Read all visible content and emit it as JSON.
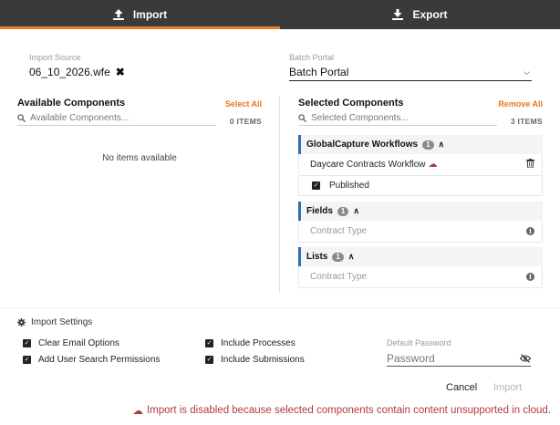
{
  "tabs": [
    {
      "label": "Import",
      "icon": "upload-icon",
      "active": true
    },
    {
      "label": "Export",
      "icon": "download-icon",
      "active": false
    }
  ],
  "import_source": {
    "label": "Import Source",
    "value": "06_10_2026.wfe"
  },
  "batch_portal": {
    "label": "Batch Portal",
    "selected": "Batch Portal"
  },
  "available": {
    "title": "Available Components",
    "action": "Select All",
    "search_placeholder": "Available Components...",
    "count": "0 ITEMS",
    "empty_text": "No items available"
  },
  "selected": {
    "title": "Selected Components",
    "action": "Remove All",
    "search_placeholder": "Selected Components...",
    "count": "3 ITEMS",
    "groups": [
      {
        "name": "GlobalCapture Workflows",
        "badge": "1",
        "items": [
          {
            "label": "Daycare Contracts Workflow",
            "icon": "cloud-icon",
            "action_icon": "trash-icon"
          }
        ],
        "checkbox": {
          "label": "Published",
          "checked": true
        }
      },
      {
        "name": "Fields",
        "badge": "1",
        "items": [
          {
            "label": "Contract Type",
            "action_icon": "info-icon"
          }
        ]
      },
      {
        "name": "Lists",
        "badge": "1",
        "items": [
          {
            "label": "Contract Type",
            "action_icon": "info-icon"
          }
        ]
      }
    ]
  },
  "settings": {
    "title": "Import Settings",
    "options": [
      {
        "label": "Clear Email Options",
        "checked": true
      },
      {
        "label": "Include Processes",
        "checked": true
      },
      {
        "label": "Add User Search Permissions",
        "checked": true
      },
      {
        "label": "Include Submissions",
        "checked": true
      }
    ],
    "password_label": "Default Password",
    "password_placeholder": "Password"
  },
  "buttons": {
    "cancel": "Cancel",
    "import": "Import"
  },
  "error": "Import is disabled because selected components contain content unsupported in cloud.",
  "colors": {
    "accent": "#f07a22",
    "group_bar": "#2f6fb6",
    "error": "#b23b3b",
    "tabbar": "#3a3a3a"
  }
}
